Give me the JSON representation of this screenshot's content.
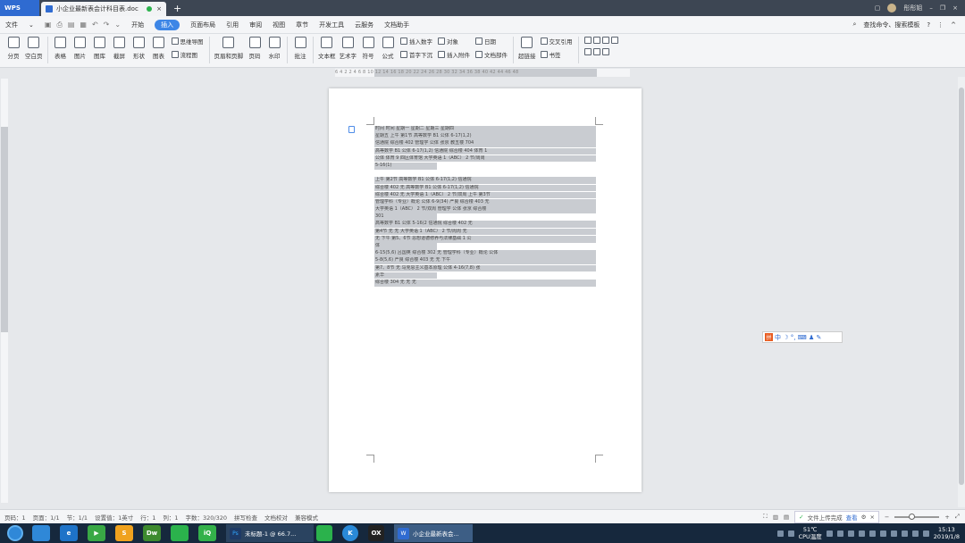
{
  "titlebar": {
    "app_name": "WPS",
    "doc_tab": "小企业最新表会计科目表.doc",
    "new_tab": "+",
    "user_name": "彤彤姐"
  },
  "menubar": {
    "file": "文件",
    "items": [
      "开始",
      "插入",
      "页面布局",
      "引用",
      "审阅",
      "视图",
      "章节",
      "开发工具",
      "云服务",
      "文档助手"
    ],
    "active_index": 1,
    "search": "查找命令、搜索模板",
    "help": "?"
  },
  "ribbon": {
    "big": [
      "分页",
      "空白页",
      "表格",
      "图片",
      "图库",
      "截屏",
      "形状",
      "图表"
    ],
    "small_a": [
      "思维导图",
      "流程图"
    ],
    "big2": [
      "页眉和页脚",
      "页码",
      "水印",
      "批注",
      "文本框",
      "艺术字",
      "符号",
      "公式"
    ],
    "small_b": [
      "插入数字",
      "首字下沉"
    ],
    "small_c": [
      "对象",
      "插入附件"
    ],
    "small_d": [
      "日期",
      "文档部件"
    ],
    "big3": [
      "超链接"
    ],
    "small_e": [
      "交叉引用",
      "书签"
    ]
  },
  "ruler": {
    "nums": "6 4 2  2 4 6 8 10 12 14 16 18 20 22 24 26 28 30 32 34 36 38 40 42 44 46 48"
  },
  "document": {
    "lines": [
      "时间      时间      星期一      星期二      星期三      星期四",
      "星期五    上午      第1节       高等数学 B1  公体       6-17(1,2)",
      "信通院    综合楼 402  管理学      公体       张京       教五楼 704",
      "高等数学 B1  公体     6-17(1,2)   信通院     综合楼 404   体育 1",
      "公体      体育 9    四区体育馆   大学英语 1（ABC）       2 节/周周",
      "5-16(1)",
      "",
      "上午      第2节     高等数学 B1  公体       6-17(1,2)   信通院",
      "综合楼 402  无      高等数学 B1  公体       6-17(1,2)   信通院",
      "综合楼 402  无      大学英语 1（ABC）       2 节/双周   上午  第3节",
      "管理学科（专业）概论  公体       6-9(34)    严良       综合楼 403 无",
      "大学英语 1（ABC）   2 节/双周   管理学     公体       张京  综合楼",
      "301",
      "高等数学 B1  公体     5-16(2      信通院     综合楼 402   无",
      "第4节     无        无         大学英语 1（ABC）       2 节/周周  无",
      "无        下午      第5、6节     思想道德修养与法律基础 1   公",
      "体",
      "6-15(5,6)  吕国英   综合楼 302   无         管理学科（专业）概论  公体",
      "5-8(5,6)   严良     综合楼 403   无         无         下午",
      "第7、8节   无        马克思主义基本原理      公体       4-16(7,8) 张",
      "素华",
      "综合楼 304  无      无         无"
    ]
  },
  "ime": {
    "logo": "拼",
    "text": "中 ☽ °, ⌨ ♟ ✎"
  },
  "statusbar": {
    "items": [
      "页码：1",
      "页面：1/1",
      "节：1/1",
      "设置值：1英寸",
      "行：1",
      "列：1",
      "字数：320/320",
      "拼写检查",
      "文档校对",
      "兼容模式"
    ],
    "upload_text": "文件上传完成",
    "upload_link": "查看",
    "zoom_minus": "−",
    "zoom_plus": "+"
  },
  "taskbar": {
    "apps": [
      {
        "label": "",
        "color": "#2f88d8"
      },
      {
        "label": "e",
        "color": "#1e73c8"
      },
      {
        "label": "▶",
        "color": "#39a845"
      },
      {
        "label": "S",
        "color": "#f0a21e"
      },
      {
        "label": "Dw",
        "color": "#3d8a2f"
      },
      {
        "label": "",
        "color": "#2bb24c"
      },
      {
        "label": "iQ",
        "color": "#33b14a"
      }
    ],
    "windows": [
      {
        "icon": "Ps",
        "label": "未标题-1 @ 66.7...",
        "icon_color": "#1e3a66"
      },
      {
        "icon": "",
        "label": "",
        "icon_color": "#2bb24c"
      },
      {
        "icon": "K",
        "label": "",
        "icon_color": "#2a8ad8"
      },
      {
        "icon": "OX",
        "label": "",
        "icon_color": "#222"
      }
    ],
    "active_window": "小企业最新表会...",
    "temp": "51℃",
    "temp_label": "CPU温度",
    "time": "15:13",
    "date": "2019/1/8"
  }
}
